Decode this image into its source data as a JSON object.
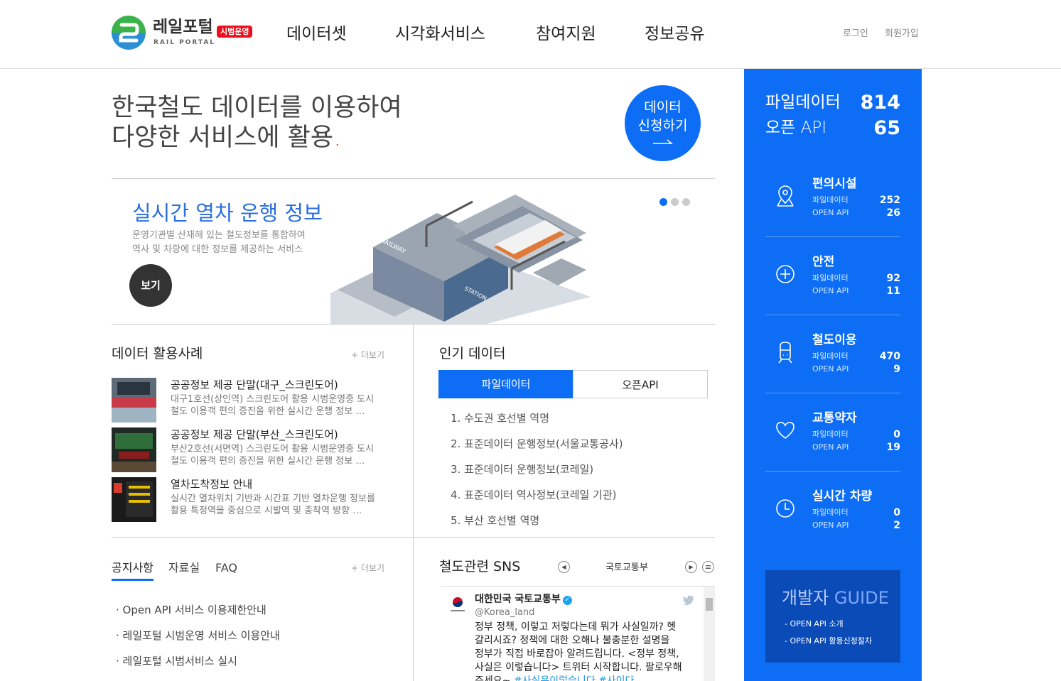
{
  "header": {
    "logo_text": "레일포털",
    "logo_sub": "RAIL PORTAL",
    "logo_badge": "시범운영",
    "nav": [
      "데이터셋",
      "시각화서비스",
      "참여지원",
      "정보공유"
    ],
    "login": "로그인",
    "signup": "회원가입"
  },
  "hero": {
    "line1": "한국철도 데이터를 이용하여",
    "line2": "다양한 서비스에 활용",
    "dot": ".",
    "apply_line1": "데이터",
    "apply_line2": "신청하기"
  },
  "slide": {
    "title": "실시간 열차 운행 정보",
    "desc1": "운영기관별 산재해 있는 철도정보를 통합하여",
    "desc2": "역사 및 차량에 대한 정보를 제공하는 서비스",
    "button": "보기",
    "active_index": 1,
    "total": 3
  },
  "cases": {
    "title": "데이터 활용사례",
    "more": "+ 더보기",
    "items": [
      {
        "title": "공공정보 제공 단말(대구_스크린도어)",
        "line1": "대구1호선(상인역) 스크린도어 활용 시범운영중 도시",
        "line2": "철도 이용객 편의 증진을 위한 실시간 운행 정보 …"
      },
      {
        "title": "공공정보 제공 단말(부산_스크린도어)",
        "line1": "부산2호선(서면역) 스크린도어 활용 시범운영중 도시",
        "line2": "철도 이용객 편의 증진을 위한 실시간 운행 정보 …"
      },
      {
        "title": "열차도착정보 안내",
        "line1": "실시간 열차위치 기반과 시간표 기반 열차운행 정보를",
        "line2": "활용 특정역을 중심으로 시발역 및 종착역 방향 …"
      }
    ]
  },
  "popular": {
    "title": "인기 데이터",
    "tab_file": "파일데이터",
    "tab_api": "오픈API",
    "items": [
      "1. 수도권 호선별 역명",
      "2. 표준데이터 운행정보(서울교통공사)",
      "3. 표준데이터 운행정보(코레일)",
      "4. 표준데이터 역사정보(코레일 기관)",
      "5. 부산 호선별 역명"
    ]
  },
  "notice": {
    "tabs": [
      "공지사항",
      "자료실",
      "FAQ"
    ],
    "more": "+ 더보기",
    "items": [
      "· Open API 서비스 이용제한안내",
      "· 레일포털 시범운영 서비스 이용안내",
      "· 레일포털 시범서비스 실시"
    ]
  },
  "sns": {
    "title": "철도관련 SNS",
    "account": "국토교통부",
    "prev": "◀",
    "next": "▶",
    "menu": "≡",
    "tweet": {
      "name": "대한민국 국토교통부",
      "verified": "✓",
      "handle": "@Korea_land",
      "line1": "정부 정책, 이렇고 저렇다는데 뭐가 사실일까? 헷",
      "line2": "갈리시죠? 정책에 대한 오해나 불충분한 설명을",
      "line3": "정부가 직접 바로잡아 알려드립니다. <정부 정책,",
      "line4": "사실은 이렇습니다> 트위터 시작합니다. 팔로우해",
      "line5_prefix": "주세요~ ",
      "line5_tags": "#사실은이렇습니다 #사이다"
    }
  },
  "sidebar": {
    "file_label": "파일데이터",
    "file_value": "814",
    "api_label": "오픈 API",
    "api_value": "65",
    "categories": [
      {
        "name": "편의시설",
        "file_label": "파일데이터",
        "api_label": "OPEN API",
        "file": "252",
        "api": "26",
        "icon": "location-pin-icon"
      },
      {
        "name": "안전",
        "file_label": "파일데이터",
        "api_label": "OPEN API",
        "file": "92",
        "api": "11",
        "icon": "plus-circle-icon"
      },
      {
        "name": "철도이용",
        "file_label": "파일데이터",
        "api_label": "OPEN API",
        "file": "470",
        "api": "9",
        "icon": "train-icon"
      },
      {
        "name": "교통약자",
        "file_label": "파일데이터",
        "api_label": "OPEN API",
        "file": "0",
        "api": "19",
        "icon": "heart-icon"
      },
      {
        "name": "실시간 차량",
        "file_label": "파일데이터",
        "api_label": "OPEN API",
        "file": "0",
        "api": "2",
        "icon": "clock-icon"
      }
    ],
    "guide_prefix": "개발자",
    "guide_word": "GUIDE",
    "guide_link1": "- OPEN API 소개",
    "guide_link2": "- OPEN API 활용신청절차"
  },
  "colors": {
    "accent": "#0d6ef5",
    "badge": "#e8101e",
    "guide_bg": "#0b4bb8"
  }
}
